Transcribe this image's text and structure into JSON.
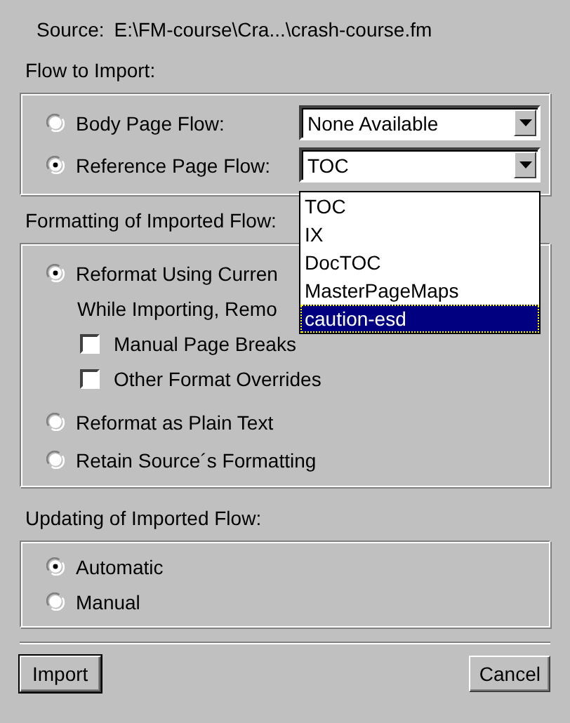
{
  "source": {
    "label": "Source:",
    "path": "E:\\FM-course\\Cra...\\crash-course.fm"
  },
  "flow_to_import": {
    "heading": "Flow to Import:",
    "options": [
      {
        "label": "Body Page Flow:",
        "selected": false,
        "combo_value": "None Available"
      },
      {
        "label": "Reference Page Flow:",
        "selected": true,
        "combo_value": "TOC",
        "list_items": [
          {
            "label": "TOC",
            "selected": false
          },
          {
            "label": "IX",
            "selected": false
          },
          {
            "label": "DocTOC",
            "selected": false
          },
          {
            "label": "MasterPageMaps",
            "selected": false
          },
          {
            "label": "caution-esd",
            "selected": true
          }
        ]
      }
    ]
  },
  "formatting": {
    "heading": "Formatting of Imported Flow:",
    "items": [
      {
        "kind": "radio",
        "label": "Reformat Using Curren",
        "selected": true
      },
      {
        "kind": "note",
        "label": "While Importing, Remo"
      },
      {
        "kind": "checkbox",
        "label": "Manual Page Breaks",
        "checked": false
      },
      {
        "kind": "checkbox",
        "label": "Other Format Overrides",
        "checked": false
      },
      {
        "kind": "radio",
        "label": "Reformat as Plain Text",
        "selected": false
      },
      {
        "kind": "radio",
        "label": "Retain Source´s Formatting",
        "selected": false
      }
    ]
  },
  "updating": {
    "heading": "Updating of Imported Flow:",
    "options": [
      {
        "label": "Automatic",
        "selected": true
      },
      {
        "label": "Manual",
        "selected": false
      }
    ]
  },
  "buttons": [
    {
      "label": "Import",
      "default": true
    },
    {
      "label": "Cancel",
      "default": false
    }
  ]
}
